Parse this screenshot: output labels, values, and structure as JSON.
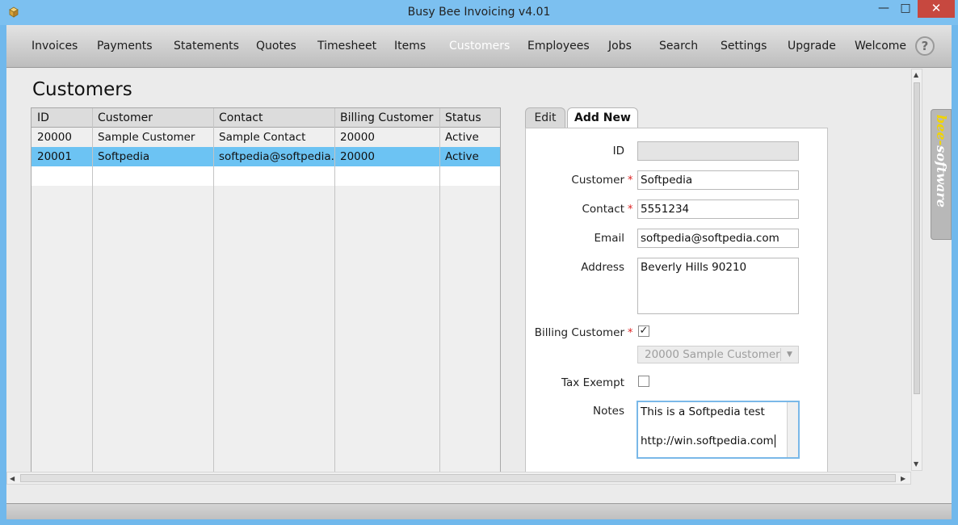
{
  "window": {
    "title": "Busy Bee Invoicing v4.01",
    "minimize": "—",
    "maximize": "□",
    "close": "✕"
  },
  "nav": {
    "items": [
      "Invoices",
      "Payments",
      "Statements",
      "Quotes",
      "Timesheet",
      "Items",
      "Customers",
      "Employees",
      "Jobs",
      "Search",
      "Settings",
      "Upgrade",
      "Welcome"
    ],
    "active": "Customers",
    "help": "?"
  },
  "page": {
    "title": "Customers"
  },
  "table": {
    "columns": [
      "ID",
      "Customer",
      "Contact",
      "Billing Customer",
      "Status"
    ],
    "rows": [
      [
        "20000",
        "Sample Customer",
        "Sample Contact",
        "20000",
        "Active"
      ],
      [
        "20001",
        "Softpedia",
        "softpedia@softpedia.com",
        "20000",
        "Active"
      ]
    ],
    "selected_row": 1
  },
  "tabs": {
    "edit": "Edit",
    "add_new": "Add New",
    "active": "Add New"
  },
  "form": {
    "id": {
      "label": "ID",
      "value": ""
    },
    "customer": {
      "label": "Customer",
      "value": "Softpedia",
      "required": "*"
    },
    "contact": {
      "label": "Contact",
      "value": "5551234",
      "required": "*"
    },
    "email": {
      "label": "Email",
      "value": "softpedia@softpedia.com"
    },
    "address": {
      "label": "Address",
      "value": "Beverly Hills 90210"
    },
    "billing_customer": {
      "label": "Billing Customer",
      "required": "*",
      "checked": "✓",
      "select_value": "20000 Sample Customer",
      "select_arrow": "▼"
    },
    "tax_exempt": {
      "label": "Tax Exempt",
      "checked": ""
    },
    "notes": {
      "label": "Notes",
      "line1": "This is a Softpedia test",
      "line2": "http://win.softpedia.com"
    }
  },
  "brand": {
    "part1": "bee-",
    "part2": "software"
  },
  "scroll": {
    "up": "▲",
    "down": "▼",
    "left": "◀",
    "right": "▶"
  },
  "colors": {
    "selected_row": "#6cc3f3",
    "title_bar": "#7cc0f0",
    "close_button": "#c7483f",
    "brand_accent": "#f1d400"
  }
}
